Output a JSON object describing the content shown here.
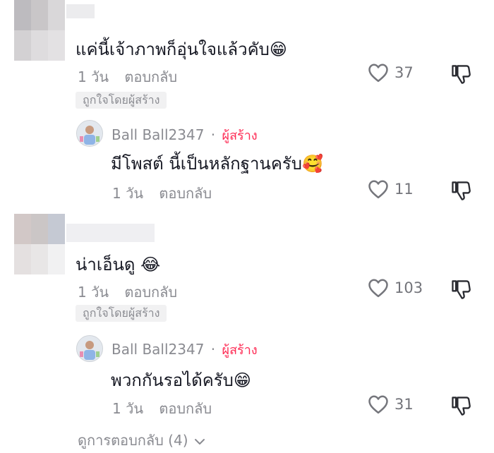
{
  "comments": [
    {
      "text": "แค่นี้เจ้าภาพก็อุ่นใจแล้วคับ",
      "emoji": "😁",
      "time": "1 วัน",
      "reply_label": "ตอบกลับ",
      "liked_by_creator": "ถูกใจโดยผู้สร้าง",
      "likes": "37",
      "reply": {
        "author": "Ball Ball2347",
        "separator": "·",
        "creator_label": "ผู้สร้าง",
        "text": "มีโพสต์ นี้เป็นหลักฐานครับ",
        "emoji": "🥰",
        "time": "1 วัน",
        "reply_label": "ตอบกลับ",
        "likes": "11"
      }
    },
    {
      "text": "น่าเอ็นดู",
      "emoji": "😂",
      "time": "1 วัน",
      "reply_label": "ตอบกลับ",
      "liked_by_creator": "ถูกใจโดยผู้สร้าง",
      "likes": "103",
      "reply": {
        "author": "Ball Ball2347",
        "separator": "·",
        "creator_label": "ผู้สร้าง",
        "text": "พวกกันรอได้ครับ",
        "emoji": "😁",
        "time": "1 วัน",
        "reply_label": "ตอบกลับ",
        "likes": "31"
      }
    }
  ],
  "view_replies": "ดูการตอบกลับ (4)",
  "icons": {
    "like": "heart-outline-icon",
    "dislike": "thumbs-down-icon",
    "expand": "chevron-down-icon"
  },
  "colors": {
    "creator": "#fe2c55",
    "meta": "#8a8b91",
    "text": "#161823"
  }
}
